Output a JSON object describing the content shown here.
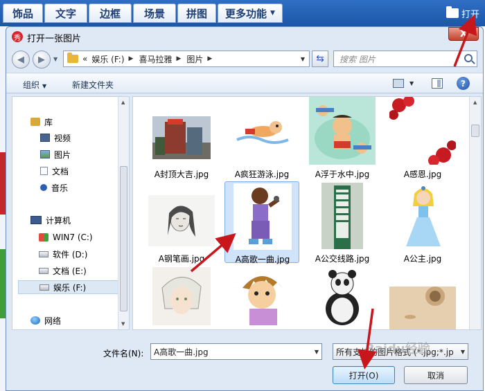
{
  "app_toolbar": {
    "tabs": [
      {
        "label": "饰品"
      },
      {
        "label": "文字"
      },
      {
        "label": "边框"
      },
      {
        "label": "场景"
      },
      {
        "label": "拼图"
      },
      {
        "label": "更多功能"
      }
    ],
    "open_label": "打开"
  },
  "dialog": {
    "badge": "秀",
    "title": "打开一张图片",
    "close_label": "X"
  },
  "address": {
    "prefix": "«",
    "parts": [
      "娱乐 (F:)",
      "喜马拉雅",
      "图片"
    ],
    "search_placeholder": "搜索 图片"
  },
  "command_bar": {
    "organize": "组织",
    "new_folder": "新建文件夹",
    "help": "?"
  },
  "nav_tree": [
    {
      "label": "库",
      "icon": "library-icon"
    },
    {
      "label": "视频",
      "icon": "video-icon"
    },
    {
      "label": "图片",
      "icon": "pictures-icon"
    },
    {
      "label": "文档",
      "icon": "documents-icon"
    },
    {
      "label": "音乐",
      "icon": "music-icon"
    },
    {
      "label": "计算机",
      "icon": "computer-icon"
    },
    {
      "label": "WIN7 (C:)",
      "icon": "windows-drive-icon"
    },
    {
      "label": "软件 (D:)",
      "icon": "drive-icon"
    },
    {
      "label": "文档 (E:)",
      "icon": "drive-icon"
    },
    {
      "label": "娱乐 (F:)",
      "icon": "drive-icon",
      "selected": true
    },
    {
      "label": "网络",
      "icon": "network-icon"
    }
  ],
  "files": [
    {
      "name": "A封顶大吉.jpg"
    },
    {
      "name": "A疯狂游泳.jpg"
    },
    {
      "name": "A浮于水中.jpg"
    },
    {
      "name": "A感恩.jpg"
    },
    {
      "name": "A钢笔画.jpg"
    },
    {
      "name": "A高歌一曲.jpg",
      "selected": true
    },
    {
      "name": "A公交线路.jpg"
    },
    {
      "name": "A公主.jpg"
    },
    {
      "name": ""
    },
    {
      "name": ""
    },
    {
      "name": ""
    },
    {
      "name": ""
    }
  ],
  "bottom": {
    "filename_label": "文件名(N):",
    "filename_value": "A高歌一曲.jpg",
    "filetype_value": "所有支持的图片格式 (*.jpg;*.jp",
    "open_button": "打开(O)",
    "cancel_button": "取消"
  },
  "watermark": "Baidu经验",
  "colors": {
    "toolbar_blue": "#1c56a8",
    "selection": "#cfe3fb",
    "arrow_red": "#c8161d"
  }
}
